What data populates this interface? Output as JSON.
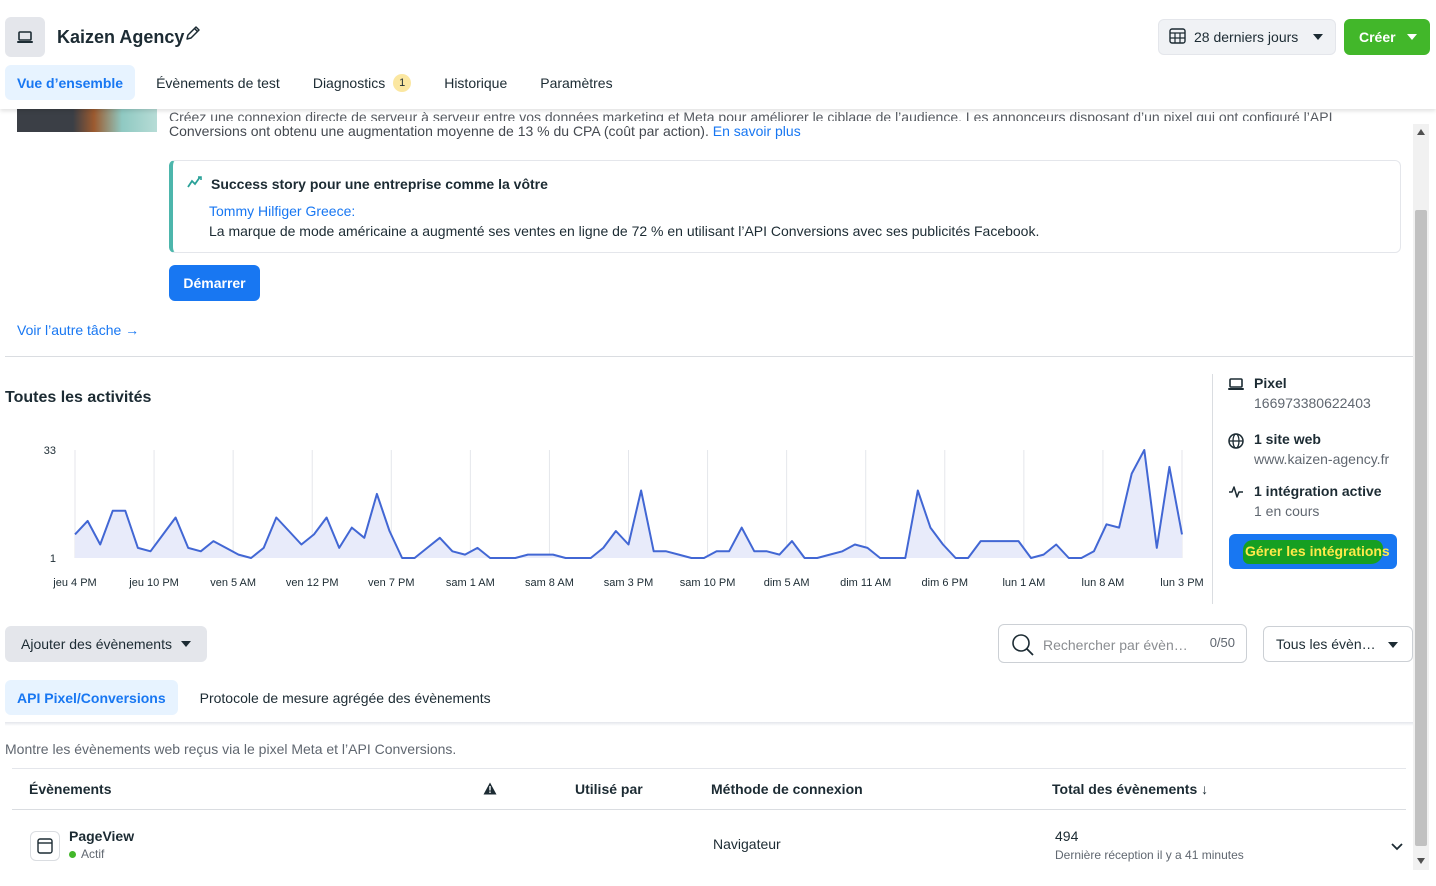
{
  "header": {
    "title": "Kaizen Agency",
    "date_range": "28 derniers jours",
    "create_label": "Créer",
    "tabs": [
      {
        "label": "Vue d’ensemble"
      },
      {
        "label": "Évènements de test"
      },
      {
        "label": "Diagnostics",
        "badge": "1"
      },
      {
        "label": "Historique"
      },
      {
        "label": "Paramètres"
      }
    ]
  },
  "task": {
    "intro_cut": "Créez une connexion directe de serveur à serveur entre vos données marketing et Meta pour améliorer le ciblage de l’audience. Les annonceurs disposant d’un pixel qui ont configuré l’API",
    "intro_line": "Conversions ont obtenu une augmentation moyenne de 13 % du CPA (coût par action).",
    "learn_more": "En savoir plus",
    "story_title": "Success story pour une entreprise comme la vôtre",
    "story_brand": "Tommy Hilfiger Greece:",
    "story_body": "La marque de mode américaine a augmenté ses ventes en ligne de 72 % en utilisant l’API Conversions avec ses publicités Facebook.",
    "start_label": "Démarrer",
    "other_task": "Voir l’autre tâche →"
  },
  "activities": {
    "title": "Toutes les activités"
  },
  "chart_data": {
    "type": "area",
    "title": "",
    "ylim": [
      1,
      33
    ],
    "y_ticks": [
      "33",
      "1"
    ],
    "x_tick_labels": [
      "jeu 4 PM",
      "jeu 10 PM",
      "ven 5 AM",
      "ven 12 PM",
      "ven 7 PM",
      "sam 1 AM",
      "sam 8 AM",
      "sam 3 PM",
      "sam 10 PM",
      "dim 5 AM",
      "dim 11 AM",
      "dim 6 PM",
      "lun 1 AM",
      "lun 8 AM",
      "lun 3 PM"
    ],
    "x_points": 86,
    "values": [
      8,
      12,
      5,
      15,
      15,
      4,
      3,
      8,
      13,
      4,
      3,
      6,
      4,
      2,
      1,
      4,
      13,
      9,
      5,
      8,
      13,
      4,
      10,
      7,
      20,
      9,
      1,
      1,
      4,
      7,
      3,
      2,
      4,
      1,
      1,
      1,
      2,
      2,
      2,
      1,
      1,
      1,
      4,
      9,
      5,
      21,
      3,
      3,
      2,
      1,
      1,
      3,
      3,
      10,
      3,
      3,
      2,
      6,
      1,
      1,
      2,
      3,
      5,
      4,
      1,
      1,
      1,
      21,
      10,
      5,
      1,
      1,
      6,
      6,
      6,
      6,
      1,
      2,
      5,
      1,
      1,
      3,
      11,
      10,
      26,
      33,
      4,
      28,
      8
    ],
    "color": "#4267d4",
    "fill": "#e8ebfa"
  },
  "side": {
    "pixel_title": "Pixel",
    "pixel_id": "166973380622403",
    "site_title": "1 site web",
    "site_url": "www.kaizen-agency.fr",
    "integr_title": "1 intégration active",
    "integr_status": "1 en cours",
    "manage_label": "Gérer les intégrations"
  },
  "events": {
    "add_label": "Ajouter des évènements",
    "search_placeholder": "Rechercher par évène…",
    "search_count": "0/50",
    "filter_label": "Tous les évène…",
    "subtabs": [
      {
        "label": "API Pixel/Conversions"
      },
      {
        "label": "Protocole de mesure agrégée des évènements"
      }
    ],
    "description": "Montre les évènements web reçus via le pixel Meta et l’API Conversions.",
    "columns": {
      "events": "Évènements",
      "used_by": "Utilisé par",
      "method": "Méthode de connexion",
      "total": "Total des évènements ↓"
    },
    "rows": [
      {
        "name": "PageView",
        "status": "Actif",
        "method": "Navigateur",
        "total": "494",
        "last": "Dernière réception il y a 41 minutes"
      }
    ]
  }
}
